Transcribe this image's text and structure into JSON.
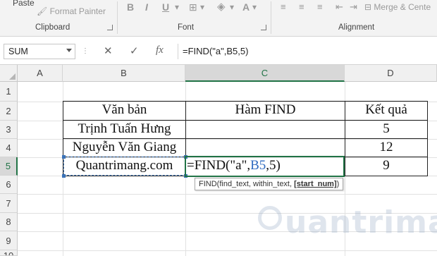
{
  "ribbon": {
    "paste_label": "Paste",
    "format_painter_label": "Format Painter",
    "merge_center_label": "Merge & Cente",
    "groups": {
      "clipboard": "Clipboard",
      "font": "Font",
      "alignment": "Alignment"
    },
    "format_buttons": {
      "bold": "B",
      "italic": "I",
      "underline": "U",
      "strike": "A"
    }
  },
  "formula_bar": {
    "name_box": "SUM",
    "formula": "=FIND(\"a\",B5,5)",
    "cancel_icon": "✕",
    "enter_icon": "✓",
    "fx_label": "fx"
  },
  "columns": [
    "A",
    "B",
    "C",
    "D"
  ],
  "rows": [
    "1",
    "2",
    "3",
    "4",
    "5",
    "6",
    "7",
    "8",
    "9",
    "10"
  ],
  "table": {
    "headers": [
      "Văn bản",
      "Hàm FIND",
      "Kết quả"
    ],
    "rows": [
      {
        "text": "Trịnh Tuấn Hưng",
        "formula": "",
        "result": "5"
      },
      {
        "text": "Nguyễn Văn Giang",
        "formula": "",
        "result": "12"
      },
      {
        "text": "Quantrimang.com",
        "formula_parts": [
          "=FIND(\"a\",",
          "B5",
          ",5)"
        ],
        "result": "9"
      }
    ]
  },
  "tooltip": {
    "fn": "FIND(find_text, within_text, ",
    "current_arg": "[start_num]",
    "close": ")"
  },
  "watermark": {
    "text": "uantrimang"
  }
}
